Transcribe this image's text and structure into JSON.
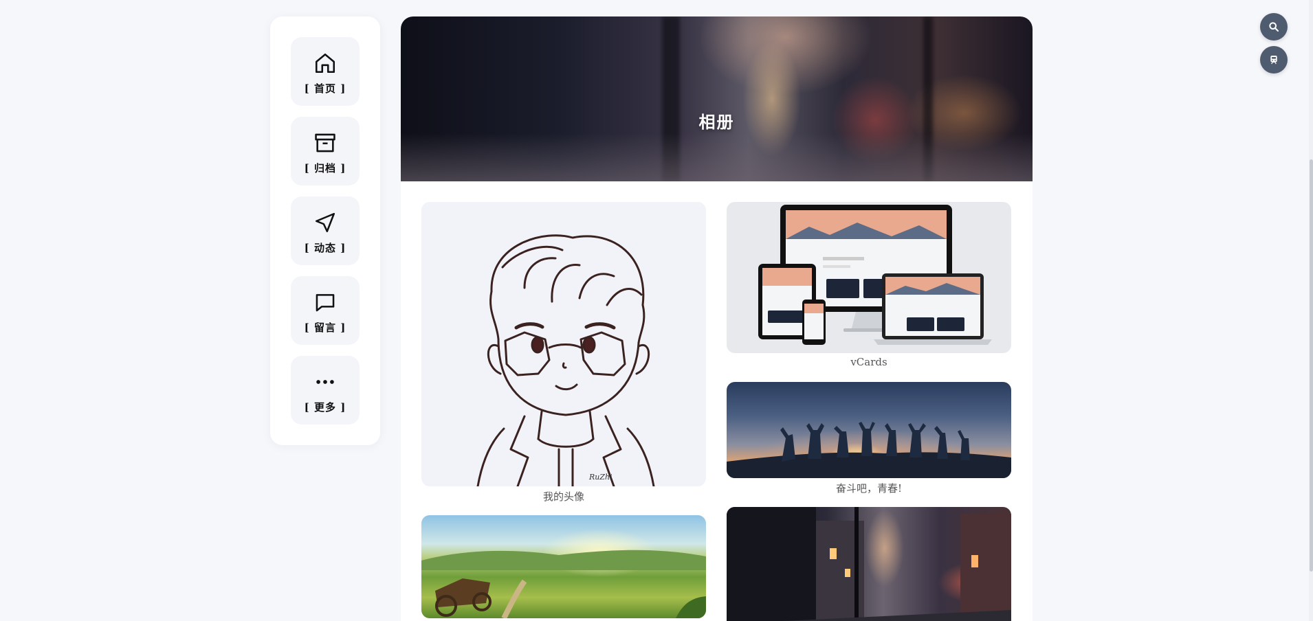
{
  "sidebar": {
    "items": [
      {
        "label": "[ 首页 ]",
        "icon": "home-icon"
      },
      {
        "label": "[ 归档 ]",
        "icon": "archive-icon"
      },
      {
        "label": "[ 动态 ]",
        "icon": "send-icon"
      },
      {
        "label": "[ 留言 ]",
        "icon": "message-icon"
      },
      {
        "label": "[ 更多 ]",
        "icon": "more-icon"
      }
    ]
  },
  "banner": {
    "title": "相册"
  },
  "album": {
    "photos": [
      {
        "caption": "我的头像",
        "signature": "RuZhi"
      },
      {
        "caption": "vCards"
      },
      {
        "caption": "奋斗吧，青春!"
      },
      {
        "caption": ""
      },
      {
        "caption": ""
      }
    ]
  },
  "floating": {
    "search_icon": "search-icon",
    "train_icon": "train-icon"
  },
  "colors": {
    "background": "#f5f7fb",
    "card": "#ffffff",
    "fab": "#4f5b6e"
  }
}
